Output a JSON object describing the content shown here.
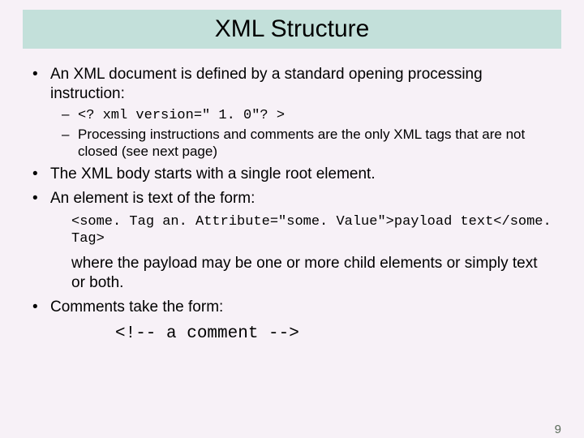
{
  "title": "XML Structure",
  "bullets": {
    "b1": "An XML document is defined by a standard opening processing instruction:",
    "b1_sub1_code": "<? xml version=\" 1. 0\"? >",
    "b1_sub2": "Processing instructions and comments are the only XML tags that are not closed (see next page)",
    "b2": "The XML body starts with a single root element.",
    "b3": "An element is text of the form:",
    "b3_code": "<some. Tag an. Attribute=\"some. Value\">payload text</some. Tag>",
    "b3_after": "where the payload may be one or more child elements or simply text or both.",
    "b4": "Comments take the form:",
    "b4_code": "<!-- a comment -->"
  },
  "page_number": "9"
}
